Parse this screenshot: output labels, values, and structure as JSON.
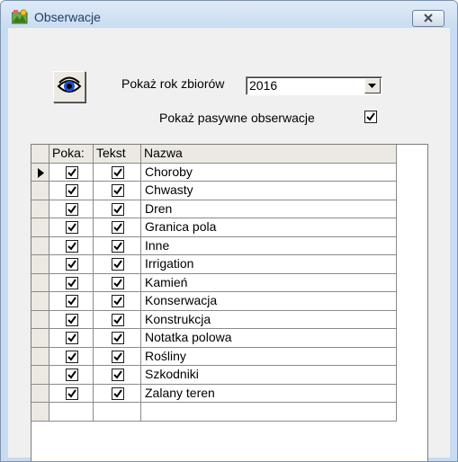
{
  "window": {
    "title": "Obserwacje",
    "icon": "app-window-icon",
    "close_icon": "close-icon"
  },
  "toolbar": {
    "eye_icon": "eye-icon",
    "year_label": "Pokaż rok zbiorów",
    "year_value": "2016",
    "passive_label": "Pokaż pasywne obserwacje",
    "passive_checked": true
  },
  "grid": {
    "columns": [
      "Poka:",
      "Tekst",
      "Nazwa"
    ],
    "rows": [
      {
        "name": "Choroby",
        "pokaz": true,
        "tekst": true,
        "current": true
      },
      {
        "name": "Chwasty",
        "pokaz": true,
        "tekst": true
      },
      {
        "name": "Dren",
        "pokaz": true,
        "tekst": true
      },
      {
        "name": "Granica pola",
        "pokaz": true,
        "tekst": true
      },
      {
        "name": "Inne",
        "pokaz": true,
        "tekst": true
      },
      {
        "name": "Irrigation",
        "pokaz": true,
        "tekst": true
      },
      {
        "name": "Kamień",
        "pokaz": true,
        "tekst": true
      },
      {
        "name": "Konserwacja",
        "pokaz": true,
        "tekst": true
      },
      {
        "name": "Konstrukcja",
        "pokaz": true,
        "tekst": true
      },
      {
        "name": "Notatka polowa",
        "pokaz": true,
        "tekst": true
      },
      {
        "name": "Rośliny",
        "pokaz": true,
        "tekst": true
      },
      {
        "name": "Szkodniki",
        "pokaz": true,
        "tekst": true
      },
      {
        "name": "Zalany teren",
        "pokaz": true,
        "tekst": true
      }
    ]
  },
  "colors": {
    "frame": "#c7dcf2",
    "title_text": "#1e3d67",
    "client": "#f0f0f0"
  }
}
